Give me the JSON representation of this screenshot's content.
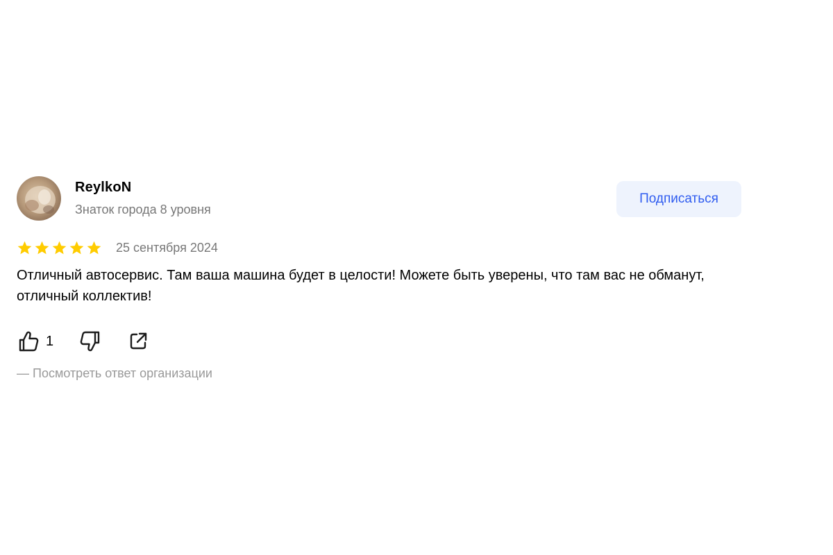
{
  "review": {
    "author": {
      "name": "ReylkoN",
      "level": "Знаток города 8 уровня"
    },
    "subscribe_label": "Подписаться",
    "rating": 5,
    "rating_max": 5,
    "date": "25 сентября 2024",
    "text": "Отличный автосервис. Там ваша машина будет в целости! Можете быть уверены, что там вас не обманут, отличный коллектив!",
    "likes": "1",
    "org_reply_link": "— Посмотреть ответ организации"
  },
  "icons": {
    "star": "star-icon",
    "like": "thumbs-up-icon",
    "dislike": "thumbs-down-icon",
    "share": "share-icon"
  },
  "colors": {
    "star": "#ffcc00",
    "accent": "#2f5cf0",
    "button_bg": "#eef3fd",
    "muted_text": "#777777",
    "link_muted": "#999999"
  }
}
